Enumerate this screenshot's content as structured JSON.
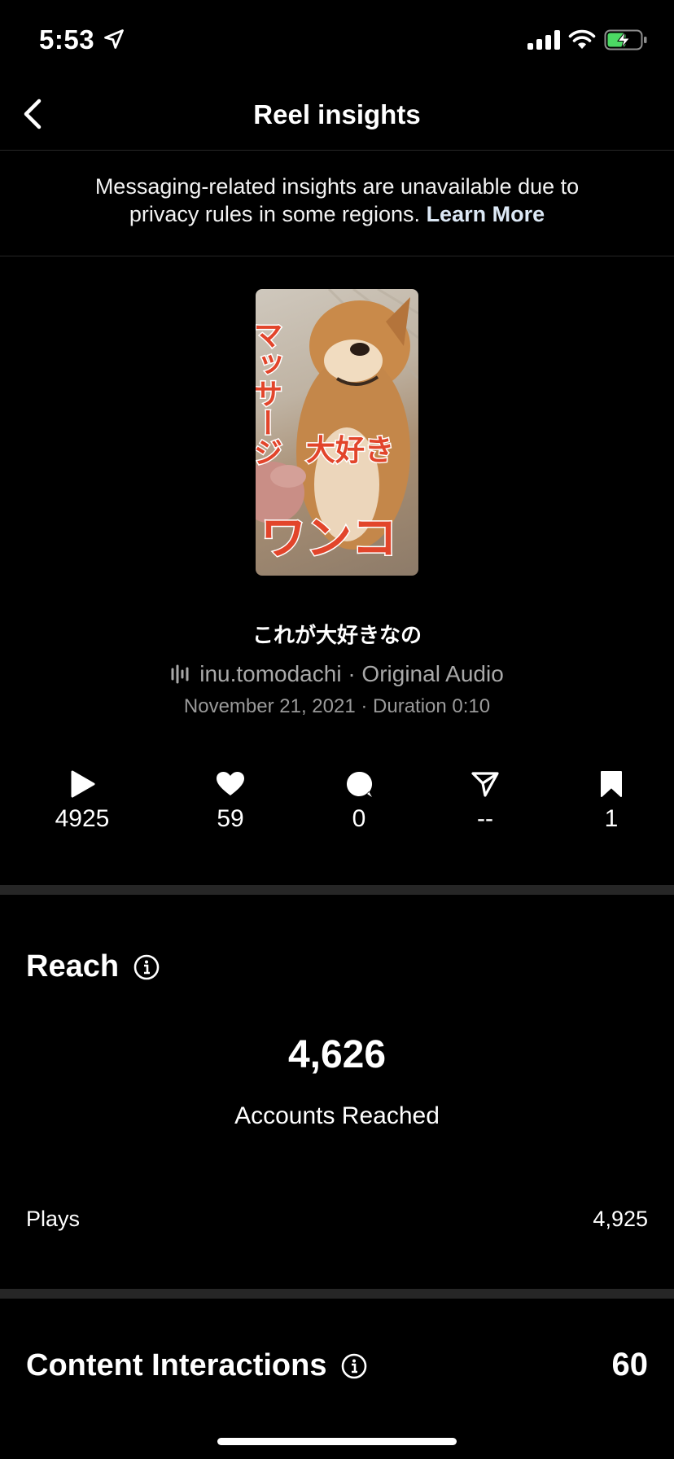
{
  "status_bar": {
    "time": "5:53"
  },
  "nav": {
    "title": "Reel insights"
  },
  "notice": {
    "line1": "Messaging-related insights are unavailable due to",
    "line2": "privacy rules in some regions.",
    "link": "Learn More"
  },
  "reel": {
    "thumbnail_text_vertical": "マッサージ",
    "thumbnail_text_mid": "大好き",
    "thumbnail_text_bottom": "ワンコ",
    "title": "これが大好きなの",
    "audio": "inu.tomodachi · Original Audio",
    "meta": "November 21, 2021 · Duration 0:10"
  },
  "stats": [
    {
      "icon": "play-icon",
      "value": "4925"
    },
    {
      "icon": "heart-icon",
      "value": "59"
    },
    {
      "icon": "comment-icon",
      "value": "0"
    },
    {
      "icon": "share-icon",
      "value": "--"
    },
    {
      "icon": "bookmark-icon",
      "value": "1"
    }
  ],
  "reach": {
    "title": "Reach",
    "number": "4,626",
    "label": "Accounts Reached",
    "plays_label": "Plays",
    "plays_value": "4,925"
  },
  "content_interactions": {
    "title": "Content Interactions",
    "value": "60"
  },
  "colors": {
    "background": "#000000",
    "divider": "#262626",
    "battery": "#4cd964"
  }
}
